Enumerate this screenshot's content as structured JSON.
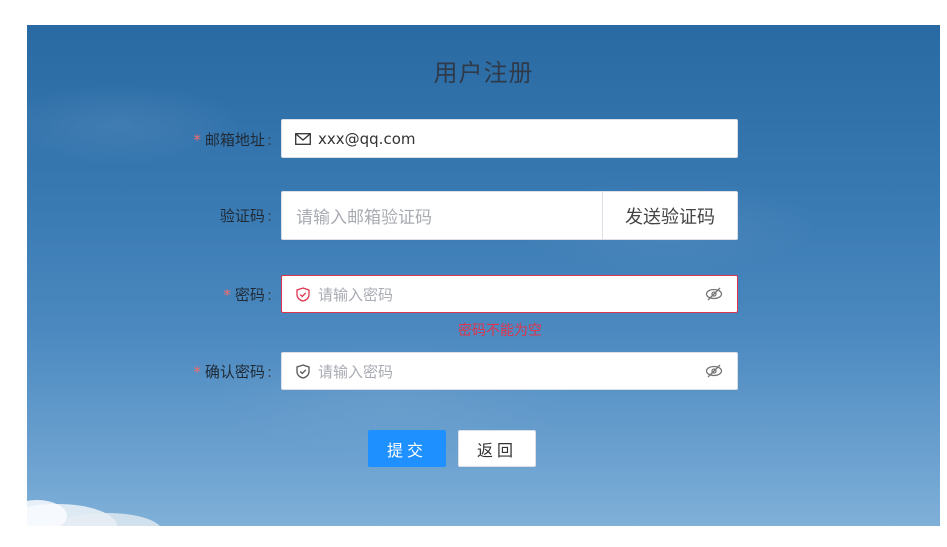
{
  "form": {
    "title": "用户注册",
    "email": {
      "label": "邮箱地址",
      "required": true,
      "value": "xxx@qq.com",
      "icon": "mail-icon"
    },
    "code": {
      "label": "验证码",
      "required": false,
      "placeholder": "请输入邮箱验证码",
      "send_label": "发送验证码"
    },
    "password": {
      "label": "密码",
      "required": true,
      "placeholder": "请输入密码",
      "icon": "shield-icon",
      "error": "密码不能为空"
    },
    "confirm": {
      "label": "确认密码",
      "required": true,
      "placeholder": "请输入密码",
      "icon": "shield-icon"
    },
    "colon": ":",
    "star": "*",
    "submit_label": "提交",
    "back_label": "返回"
  },
  "colors": {
    "primary": "#1e90ff",
    "error": "#e0344d",
    "required": "#f56c6c"
  }
}
